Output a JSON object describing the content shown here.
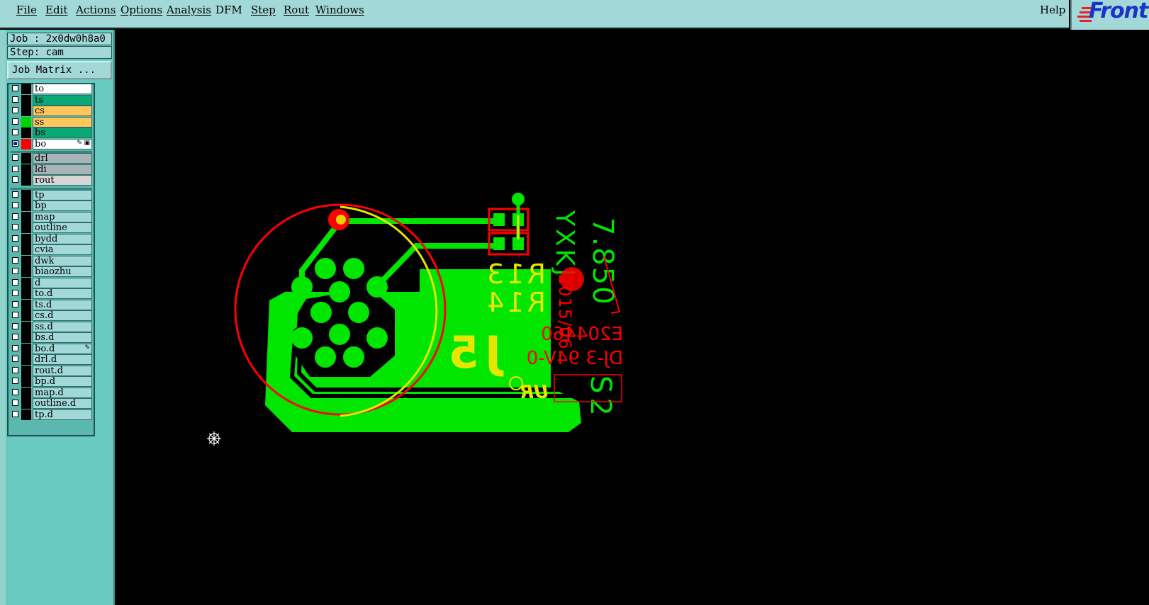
{
  "menu": {
    "file": "File",
    "edit": "Edit",
    "actions": "Actions",
    "options": "Options",
    "analysis": "Analysis",
    "dfm": "DFM",
    "step": "Step",
    "rout": "Rout",
    "windows": "Windows",
    "help": "Help"
  },
  "logo": {
    "text": "Front"
  },
  "job": {
    "job_label": "Job : 2x0dw0h8a0",
    "step_label": "Step: cam",
    "matrix_button": "Job Matrix ..."
  },
  "layers": {
    "board": [
      {
        "name": "to",
        "color": "#ffffff",
        "swatch": "#000000",
        "checked": false
      },
      {
        "name": "ts",
        "color": "#0aa874",
        "swatch": "#000000",
        "checked": false
      },
      {
        "name": "cs",
        "color": "#ffc65c",
        "swatch": "#000000",
        "checked": false
      },
      {
        "name": "ss",
        "color": "#ffc65c",
        "swatch": "#00d400",
        "checked": false
      },
      {
        "name": "bs",
        "color": "#0aa874",
        "swatch": "#000000",
        "checked": false
      },
      {
        "name": "bo",
        "color": "#ffffff",
        "swatch": "#ff0000",
        "checked": true,
        "marker": "✎ ▣"
      }
    ],
    "drill": [
      {
        "name": "drl",
        "color": "#a9b3b8",
        "swatch": "#000000",
        "checked": false
      },
      {
        "name": "ldi",
        "color": "#a9b3b8",
        "swatch": "#000000",
        "checked": false
      },
      {
        "name": "rout",
        "color": "#d6d6d6",
        "swatch": "#000000",
        "checked": false
      }
    ],
    "misc": [
      {
        "name": "tp"
      },
      {
        "name": "bp"
      },
      {
        "name": "map"
      },
      {
        "name": "outline"
      },
      {
        "name": "bydd"
      },
      {
        "name": "cvia"
      },
      {
        "name": "dwk"
      },
      {
        "name": "biaozhu"
      },
      {
        "name": "d"
      },
      {
        "name": "to.d"
      },
      {
        "name": "ts.d"
      },
      {
        "name": "cs.d"
      },
      {
        "name": "ss.d"
      },
      {
        "name": "bs.d"
      },
      {
        "name": "bo.d",
        "marker": "✎"
      },
      {
        "name": "drl.d"
      },
      {
        "name": "rout.d"
      },
      {
        "name": "bp.d"
      },
      {
        "name": "map.d"
      },
      {
        "name": "outline.d"
      },
      {
        "name": "tp.d"
      }
    ],
    "misc_color": "#a2d8d7"
  },
  "pcb": {
    "ref_r13": "R13",
    "ref_r14": "R14",
    "ref_j5": "J5",
    "text_yxkj": "YXKJ",
    "text_date": "7.850",
    "text_code": "2015/06",
    "text_ul": "E204460",
    "text_rating": "DJ-3 94V-0",
    "text_s2": "S2",
    "colors": {
      "copper": "#00e600",
      "silk": "#e6e600",
      "outline": "#ff0000"
    }
  }
}
